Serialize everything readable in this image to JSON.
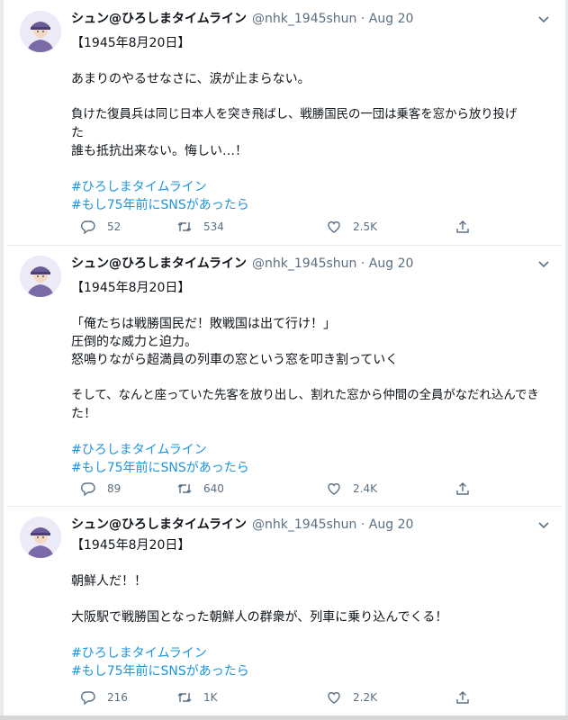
{
  "tweets": [
    {
      "name": "シュン@ひろしまタイムライン",
      "handle": "@nhk_1945shun",
      "sep": "·",
      "date": "Aug 20",
      "lines": [
        "【1945年8月20日】",
        "",
        "あまりのやるせなさに、涙が止まらない。",
        "",
        "負けた復員兵は同じ日本人を突き飛ばし、戦勝国民の一団は乗客を窓から放り投げ",
        "た",
        "誰も抵抗出来ない。悔しい…！",
        ""
      ],
      "hashtags": [
        "#ひろしまタイムライン",
        "#もし75年前にSNSがあったら"
      ],
      "replies": "52",
      "retweets": "534",
      "likes": "2.5K"
    },
    {
      "name": "シュン@ひろしまタイムライン",
      "handle": "@nhk_1945shun",
      "sep": "·",
      "date": "Aug 20",
      "lines": [
        "【1945年8月20日】",
        "",
        "「俺たちは戦勝国民だ！敗戦国は出て行け！」",
        "圧倒的な威力と迫力。",
        "怒鳴りながら超満員の列車の窓という窓を叩き割っていく",
        "",
        "そして、なんと座っていた先客を放り出し、割れた窓から仲間の全員がなだれ込んでき",
        "た！",
        ""
      ],
      "hashtags": [
        "#ひろしまタイムライン",
        "#もし75年前にSNSがあったら"
      ],
      "replies": "89",
      "retweets": "640",
      "likes": "2.4K"
    },
    {
      "name": "シュン@ひろしまタイムライン",
      "handle": "@nhk_1945shun",
      "sep": "·",
      "date": "Aug 20",
      "lines": [
        "【1945年8月20日】",
        "",
        "朝鮮人だ！！",
        "",
        "大阪駅で戦勝国となった朝鮮人の群衆が、列車に乗り込んでくる！",
        ""
      ],
      "hashtags": [
        "#ひろしまタイムライン",
        "#もし75年前にSNSがあったら"
      ],
      "replies": "216",
      "retweets": "1K",
      "likes": "2.2K"
    }
  ],
  "colors": {
    "text": "#0f1419",
    "muted": "#5b7083",
    "link": "#1b95e0",
    "border": "#e6ecf0",
    "avatar_bg": "#eceaf7"
  },
  "icons": [
    "reply-icon",
    "retweet-icon",
    "like-icon",
    "share-icon",
    "caret-down-icon",
    "avatar-icon"
  ]
}
